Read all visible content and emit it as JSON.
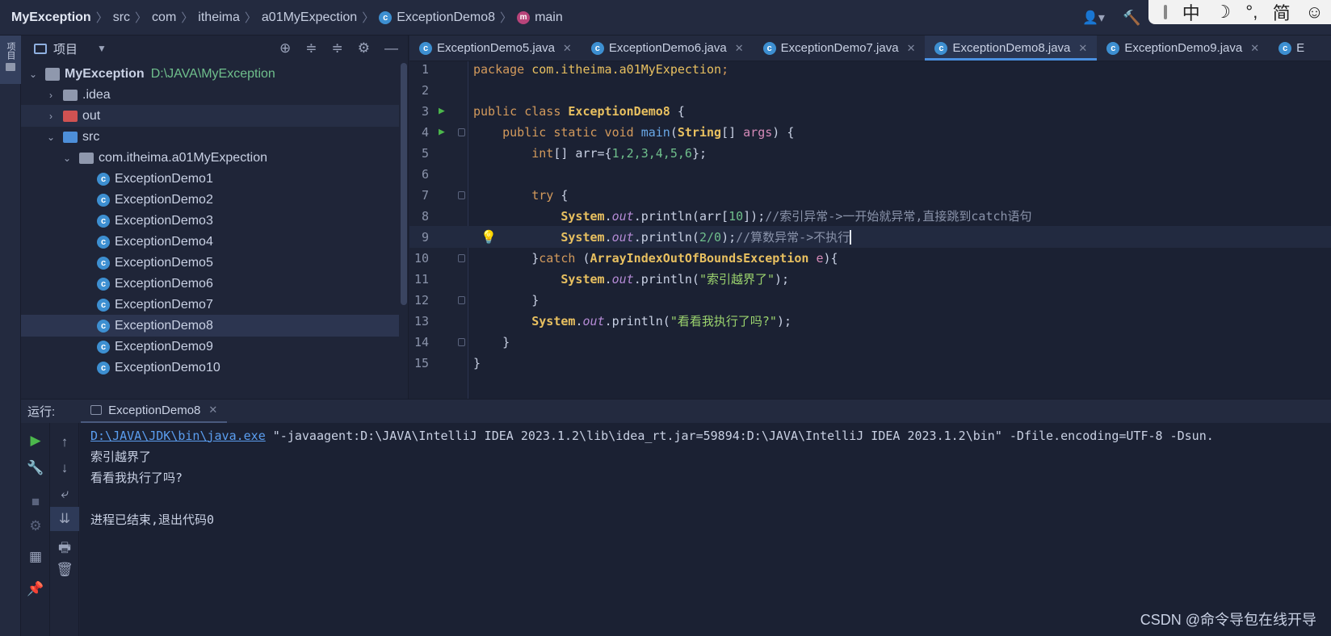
{
  "breadcrumb": {
    "project": "MyException",
    "src": "src",
    "com": "com",
    "itheima": "itheima",
    "pkg": "a01MyExpection",
    "cls": "ExceptionDemo8",
    "method": "main"
  },
  "ime": {
    "c1": "中",
    "c2": "☽",
    "c3": "°,",
    "c4": "简",
    "c5": "☺"
  },
  "sidebar_tab": "项目",
  "project_panel": {
    "title": "项目",
    "root": {
      "name": "MyException",
      "path": "D:\\JAVA\\MyException"
    },
    "items": [
      {
        "label": ".idea"
      },
      {
        "label": "out"
      },
      {
        "label": "src"
      },
      {
        "label": "com.itheima.a01MyExpection"
      },
      {
        "label": "ExceptionDemo1"
      },
      {
        "label": "ExceptionDemo2"
      },
      {
        "label": "ExceptionDemo3"
      },
      {
        "label": "ExceptionDemo4"
      },
      {
        "label": "ExceptionDemo5"
      },
      {
        "label": "ExceptionDemo6"
      },
      {
        "label": "ExceptionDemo7"
      },
      {
        "label": "ExceptionDemo8"
      },
      {
        "label": "ExceptionDemo9"
      },
      {
        "label": "ExceptionDemo10"
      }
    ]
  },
  "tabs": [
    {
      "label": "ExceptionDemo5.java"
    },
    {
      "label": "ExceptionDemo6.java"
    },
    {
      "label": "ExceptionDemo7.java"
    },
    {
      "label": "ExceptionDemo8.java"
    },
    {
      "label": "ExceptionDemo9.java"
    },
    {
      "label": "E"
    }
  ],
  "code": {
    "line_numbers": [
      "1",
      "2",
      "3",
      "4",
      "5",
      "6",
      "7",
      "8",
      "9",
      "10",
      "11",
      "12",
      "13",
      "14",
      "15"
    ],
    "l1_kw": "package ",
    "l1_pkg": "com.itheima.a01MyExpection",
    "l1_end": ";",
    "l3_kw": "public class ",
    "l3_cls": "ExceptionDemo8",
    "l3_end": " {",
    "l4_kw": "public static void ",
    "l4_fn": "main",
    "l4_a": "(",
    "l4_type": "String",
    "l4_b": "[] ",
    "l4_par": "args",
    "l4_end": ") {",
    "l5_kw": "int",
    "l5_a": "[] arr={",
    "l5_nums": "1,2,3,4,5,6",
    "l5_end": "};",
    "l7_kw": "try",
    "l7_end": " {",
    "l8_sys": "System",
    "l8_dot": ".",
    "l8_out": "out",
    "l8_a": ".println(arr[",
    "l8_num": "10",
    "l8_b": "]);",
    "l8_cm": "//索引异常->一开始就异常,直接跳到catch语句",
    "l9_sys": "System",
    "l9_dot": ".",
    "l9_out": "out",
    "l9_a": ".println(",
    "l9_num": "2/0",
    "l9_b": ");",
    "l9_cm": "//算数异常->不执行",
    "l10_a": "}",
    "l10_kw": "catch",
    "l10_b": " (",
    "l10_cls": "ArrayIndexOutOfBoundsException",
    "l10_par": " e",
    "l10_end": "){",
    "l11_sys": "System",
    "l11_dot": ".",
    "l11_out": "out",
    "l11_a": ".println(",
    "l11_str": "\"索引越界了\"",
    "l11_end": ");",
    "l12": "}",
    "l13_sys": "System",
    "l13_dot": ".",
    "l13_out": "out",
    "l13_a": ".println(",
    "l13_str": "\"看看我执行了吗?\"",
    "l13_end": ");",
    "l14": "}",
    "l15": "}"
  },
  "run": {
    "label": "运行:",
    "tab": "ExceptionDemo8",
    "cmd_link": "D:\\JAVA\\JDK\\bin\\java.exe",
    "cmd_rest": " \"-javaagent:D:\\JAVA\\IntelliJ IDEA 2023.1.2\\lib\\idea_rt.jar=59894:D:\\JAVA\\IntelliJ IDEA 2023.1.2\\bin\" -Dfile.encoding=UTF-8 -Dsun.",
    "out1": "索引越界了",
    "out2": "看看我执行了吗?",
    "out3": "进程已结束,退出代码0"
  },
  "watermark": "CSDN @命令导包在线开导"
}
